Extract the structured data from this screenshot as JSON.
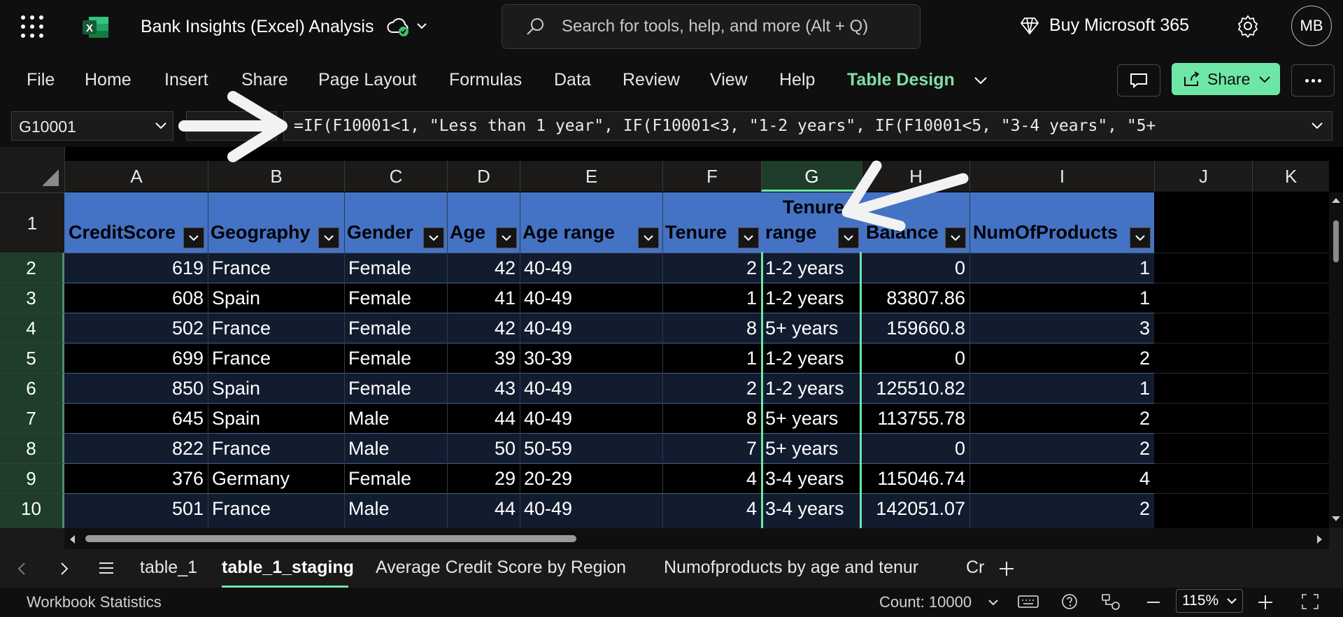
{
  "app": {
    "doc_title": "Bank Insights (Excel) Analysis",
    "search_placeholder": "Search for tools, help, and more (Alt + Q)",
    "buy_label": "Buy Microsoft 365",
    "user_initials": "MB"
  },
  "ribbon": {
    "tabs": [
      "File",
      "Home",
      "Insert",
      "Share",
      "Page Layout",
      "Formulas",
      "Data",
      "Review",
      "View",
      "Help",
      "Table Design"
    ],
    "active_tab": "Table Design",
    "share_label": "Share"
  },
  "formula_bar": {
    "cell_ref": "G10001",
    "formula": "=IF(F10001<1, \"Less than 1 year\", IF(F10001<3, \"1-2 years\", IF(F10001<5, \"3-4 years\", \"5+"
  },
  "grid": {
    "columns": [
      "A",
      "B",
      "C",
      "D",
      "E",
      "F",
      "G",
      "H",
      "I",
      "J",
      "K"
    ],
    "selected_column": "G",
    "row_numbers": [
      "1",
      "2",
      "3",
      "4",
      "5",
      "6",
      "7",
      "8",
      "9",
      "10"
    ],
    "table_headers": [
      "CreditScore",
      "Geography",
      "Gender",
      "Age",
      "Age range",
      "Tenure",
      "Tenure range",
      "Balance",
      "NumOfProducts"
    ],
    "tenure_range_header_line1": "Tenure",
    "tenure_range_header_line2": "range",
    "rows": [
      [
        "619",
        "France",
        "Female",
        "42",
        "40-49",
        "2",
        "1-2 years",
        "0",
        "1"
      ],
      [
        "608",
        "Spain",
        "Female",
        "41",
        "40-49",
        "1",
        "1-2 years",
        "83807.86",
        "1"
      ],
      [
        "502",
        "France",
        "Female",
        "42",
        "40-49",
        "8",
        "5+ years",
        "159660.8",
        "3"
      ],
      [
        "699",
        "France",
        "Female",
        "39",
        "30-39",
        "1",
        "1-2 years",
        "0",
        "2"
      ],
      [
        "850",
        "Spain",
        "Female",
        "43",
        "40-49",
        "2",
        "1-2 years",
        "125510.82",
        "1"
      ],
      [
        "645",
        "Spain",
        "Male",
        "44",
        "40-49",
        "8",
        "5+ years",
        "113755.78",
        "2"
      ],
      [
        "822",
        "France",
        "Male",
        "50",
        "50-59",
        "7",
        "5+ years",
        "0",
        "2"
      ],
      [
        "376",
        "Germany",
        "Female",
        "29",
        "20-29",
        "4",
        "3-4 years",
        "115046.74",
        "4"
      ],
      [
        "501",
        "France",
        "Male",
        "44",
        "40-49",
        "4",
        "3-4 years",
        "142051.07",
        "2"
      ]
    ]
  },
  "sheets": {
    "tabs": [
      "table_1",
      "table_1_staging",
      "Average Credit Score by Region",
      "Numofproducts by age and tenur",
      "Cr"
    ],
    "active": "table_1_staging"
  },
  "status": {
    "workbook_stats": "Workbook Statistics",
    "count": "Count: 10000",
    "zoom": "115%"
  },
  "colors": {
    "accent_green": "#6ee6a6",
    "table_header_blue": "#4472c4",
    "band_row": "#121c2f"
  }
}
